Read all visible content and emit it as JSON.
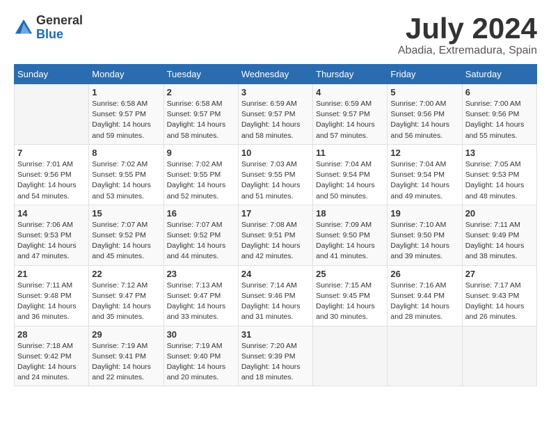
{
  "header": {
    "logo_general": "General",
    "logo_blue": "Blue",
    "month_title": "July 2024",
    "location": "Abadia, Extremadura, Spain"
  },
  "calendar": {
    "days_of_week": [
      "Sunday",
      "Monday",
      "Tuesday",
      "Wednesday",
      "Thursday",
      "Friday",
      "Saturday"
    ],
    "weeks": [
      [
        {
          "day": "",
          "info": ""
        },
        {
          "day": "1",
          "info": "Sunrise: 6:58 AM\nSunset: 9:57 PM\nDaylight: 14 hours\nand 59 minutes."
        },
        {
          "day": "2",
          "info": "Sunrise: 6:58 AM\nSunset: 9:57 PM\nDaylight: 14 hours\nand 58 minutes."
        },
        {
          "day": "3",
          "info": "Sunrise: 6:59 AM\nSunset: 9:57 PM\nDaylight: 14 hours\nand 58 minutes."
        },
        {
          "day": "4",
          "info": "Sunrise: 6:59 AM\nSunset: 9:57 PM\nDaylight: 14 hours\nand 57 minutes."
        },
        {
          "day": "5",
          "info": "Sunrise: 7:00 AM\nSunset: 9:56 PM\nDaylight: 14 hours\nand 56 minutes."
        },
        {
          "day": "6",
          "info": "Sunrise: 7:00 AM\nSunset: 9:56 PM\nDaylight: 14 hours\nand 55 minutes."
        }
      ],
      [
        {
          "day": "7",
          "info": "Sunrise: 7:01 AM\nSunset: 9:56 PM\nDaylight: 14 hours\nand 54 minutes."
        },
        {
          "day": "8",
          "info": "Sunrise: 7:02 AM\nSunset: 9:55 PM\nDaylight: 14 hours\nand 53 minutes."
        },
        {
          "day": "9",
          "info": "Sunrise: 7:02 AM\nSunset: 9:55 PM\nDaylight: 14 hours\nand 52 minutes."
        },
        {
          "day": "10",
          "info": "Sunrise: 7:03 AM\nSunset: 9:55 PM\nDaylight: 14 hours\nand 51 minutes."
        },
        {
          "day": "11",
          "info": "Sunrise: 7:04 AM\nSunset: 9:54 PM\nDaylight: 14 hours\nand 50 minutes."
        },
        {
          "day": "12",
          "info": "Sunrise: 7:04 AM\nSunset: 9:54 PM\nDaylight: 14 hours\nand 49 minutes."
        },
        {
          "day": "13",
          "info": "Sunrise: 7:05 AM\nSunset: 9:53 PM\nDaylight: 14 hours\nand 48 minutes."
        }
      ],
      [
        {
          "day": "14",
          "info": "Sunrise: 7:06 AM\nSunset: 9:53 PM\nDaylight: 14 hours\nand 47 minutes."
        },
        {
          "day": "15",
          "info": "Sunrise: 7:07 AM\nSunset: 9:52 PM\nDaylight: 14 hours\nand 45 minutes."
        },
        {
          "day": "16",
          "info": "Sunrise: 7:07 AM\nSunset: 9:52 PM\nDaylight: 14 hours\nand 44 minutes."
        },
        {
          "day": "17",
          "info": "Sunrise: 7:08 AM\nSunset: 9:51 PM\nDaylight: 14 hours\nand 42 minutes."
        },
        {
          "day": "18",
          "info": "Sunrise: 7:09 AM\nSunset: 9:50 PM\nDaylight: 14 hours\nand 41 minutes."
        },
        {
          "day": "19",
          "info": "Sunrise: 7:10 AM\nSunset: 9:50 PM\nDaylight: 14 hours\nand 39 minutes."
        },
        {
          "day": "20",
          "info": "Sunrise: 7:11 AM\nSunset: 9:49 PM\nDaylight: 14 hours\nand 38 minutes."
        }
      ],
      [
        {
          "day": "21",
          "info": "Sunrise: 7:11 AM\nSunset: 9:48 PM\nDaylight: 14 hours\nand 36 minutes."
        },
        {
          "day": "22",
          "info": "Sunrise: 7:12 AM\nSunset: 9:47 PM\nDaylight: 14 hours\nand 35 minutes."
        },
        {
          "day": "23",
          "info": "Sunrise: 7:13 AM\nSunset: 9:47 PM\nDaylight: 14 hours\nand 33 minutes."
        },
        {
          "day": "24",
          "info": "Sunrise: 7:14 AM\nSunset: 9:46 PM\nDaylight: 14 hours\nand 31 minutes."
        },
        {
          "day": "25",
          "info": "Sunrise: 7:15 AM\nSunset: 9:45 PM\nDaylight: 14 hours\nand 30 minutes."
        },
        {
          "day": "26",
          "info": "Sunrise: 7:16 AM\nSunset: 9:44 PM\nDaylight: 14 hours\nand 28 minutes."
        },
        {
          "day": "27",
          "info": "Sunrise: 7:17 AM\nSunset: 9:43 PM\nDaylight: 14 hours\nand 26 minutes."
        }
      ],
      [
        {
          "day": "28",
          "info": "Sunrise: 7:18 AM\nSunset: 9:42 PM\nDaylight: 14 hours\nand 24 minutes."
        },
        {
          "day": "29",
          "info": "Sunrise: 7:19 AM\nSunset: 9:41 PM\nDaylight: 14 hours\nand 22 minutes."
        },
        {
          "day": "30",
          "info": "Sunrise: 7:19 AM\nSunset: 9:40 PM\nDaylight: 14 hours\nand 20 minutes."
        },
        {
          "day": "31",
          "info": "Sunrise: 7:20 AM\nSunset: 9:39 PM\nDaylight: 14 hours\nand 18 minutes."
        },
        {
          "day": "",
          "info": ""
        },
        {
          "day": "",
          "info": ""
        },
        {
          "day": "",
          "info": ""
        }
      ]
    ]
  }
}
